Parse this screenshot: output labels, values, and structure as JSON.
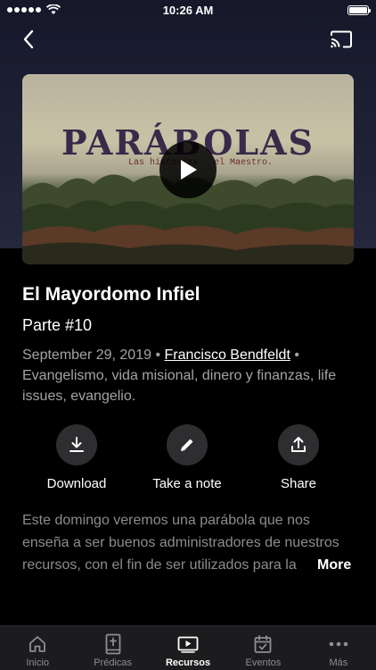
{
  "status_bar": {
    "time": "10:26 AM",
    "signal_bars": 5
  },
  "episode": {
    "title": "El Mayordomo Infiel",
    "part": "Parte #10",
    "date_prefix": "September 29, 2019 • ",
    "speaker": "Francisco Bendfeldt",
    "tags_suffix": " • Evangelismo, vida misional, dinero y finanzas, life issues, evangelio.",
    "thumbnail": {
      "title": "PARÁBOLAS",
      "subtitle": "Las historias … el Maestro."
    },
    "description": "Este domingo veremos una parábola que nos enseña a ser buenos administradores de nuestros recursos, con el fin de ser utilizados para la",
    "more_label": "More"
  },
  "actions": [
    {
      "label": "Download",
      "icon": "download-icon"
    },
    {
      "label": "Take a note",
      "icon": "pencil-icon"
    },
    {
      "label": "Share",
      "icon": "share-icon"
    }
  ],
  "tabs": [
    {
      "label": "Inicio",
      "icon": "home-icon",
      "active": false
    },
    {
      "label": "Prédicas",
      "icon": "bible-icon",
      "active": false
    },
    {
      "label": "Recursos",
      "icon": "play-icon",
      "active": true
    },
    {
      "label": "Eventos",
      "icon": "calendar-icon",
      "active": false
    },
    {
      "label": "Más",
      "icon": "more-icon",
      "active": false
    }
  ],
  "colors": {
    "background": "#000000",
    "hero": "#20223a",
    "muted_text": "#a4a4a8",
    "tabbar": "#1c1c1e",
    "action_circle": "#2e2e31"
  }
}
